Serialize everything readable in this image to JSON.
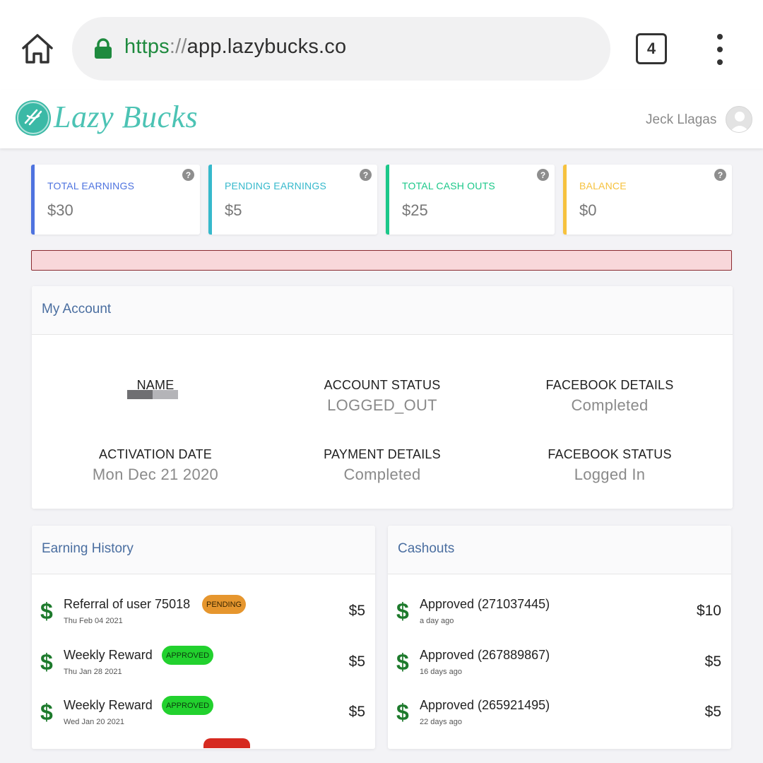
{
  "browser": {
    "url_scheme": "https",
    "url_separator": "://",
    "url_host": "app.lazybucks.co",
    "tab_count": "4"
  },
  "header": {
    "brand": "Lazy Bucks",
    "user_name": "Jeck Llagas"
  },
  "stats": [
    {
      "label": "TOTAL EARNINGS",
      "value": "$30",
      "color": "#4e73df"
    },
    {
      "label": "PENDING EARNINGS",
      "value": "$5",
      "color": "#36b9cc"
    },
    {
      "label": "TOTAL CASH OUTS",
      "value": "$25",
      "color": "#1cc88a"
    },
    {
      "label": "BALANCE",
      "value": "$0",
      "color": "#f6c23e"
    }
  ],
  "help_glyph": "?",
  "my_account": {
    "title": "My Account",
    "fields": [
      {
        "label": "NAME",
        "value": ""
      },
      {
        "label": "ACCOUNT STATUS",
        "value": "LOGGED_OUT"
      },
      {
        "label": "FACEBOOK DETAILS",
        "value": "Completed"
      },
      {
        "label": "ACTIVATION DATE",
        "value": "Mon Dec 21 2020"
      },
      {
        "label": "PAYMENT DETAILS",
        "value": "Completed"
      },
      {
        "label": "FACEBOOK STATUS",
        "value": "Logged In"
      }
    ]
  },
  "earning_history": {
    "title": "Earning History",
    "items": [
      {
        "title": "Referral of user 75018",
        "badge": "PENDING",
        "date": "Thu Feb 04 2021",
        "amount": "$5"
      },
      {
        "title": "Weekly Reward",
        "badge": "APPROVED",
        "date": "Thu Jan 28 2021",
        "amount": "$5"
      },
      {
        "title": "Weekly Reward",
        "badge": "APPROVED",
        "date": "Wed Jan 20 2021",
        "amount": "$5"
      }
    ]
  },
  "cashouts": {
    "title": "Cashouts",
    "items": [
      {
        "title": "Approved (271037445)",
        "date": "a day ago",
        "amount": "$10"
      },
      {
        "title": "Approved (267889867)",
        "date": "16 days ago",
        "amount": "$5"
      },
      {
        "title": "Approved (265921495)",
        "date": "22 days ago",
        "amount": "$5"
      }
    ]
  },
  "dollar_glyph": "$"
}
